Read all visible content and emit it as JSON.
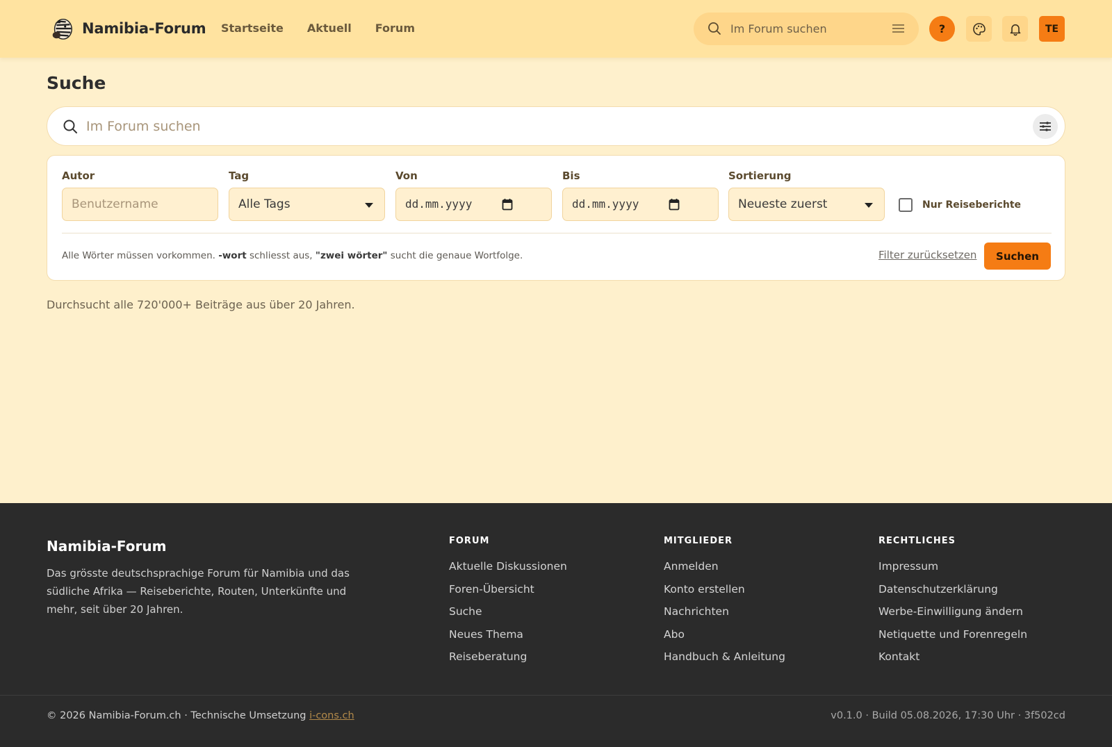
{
  "header": {
    "brand": "Namibia-Forum",
    "nav": [
      "Startseite",
      "Aktuell",
      "Forum"
    ],
    "search_placeholder": "Im Forum suchen",
    "help_label": "?",
    "avatar_initials": "TE"
  },
  "main": {
    "title": "Suche",
    "search_placeholder": "Im Forum suchen",
    "filters": {
      "author_label": "Autor",
      "author_placeholder": "Benutzername",
      "tag_label": "Tag",
      "tag_value": "Alle Tags",
      "from_label": "Von",
      "from_placeholder": "dd.mm.yyyy",
      "to_label": "Bis",
      "to_placeholder": "dd.mm.yyyy",
      "sort_label": "Sortierung",
      "sort_value": "Neueste zuerst",
      "travel_only_label": "Nur Reiseberichte",
      "travel_only_checked": false
    },
    "hint": {
      "part1": "Alle Wörter müssen vorkommen. ",
      "bold1": "-wort",
      "part2": " schliesst aus, ",
      "bold2": "\"zwei wörter\"",
      "part3": " sucht die genaue Wortfolge."
    },
    "reset_label": "Filter zurücksetzen",
    "submit_label": "Suchen",
    "note": "Durchsucht alle 720'000+ Beiträge aus über 20 Jahren."
  },
  "footer": {
    "brand": "Namibia-Forum",
    "description": "Das grösste deutschsprachige Forum für Namibia und das südliche Afrika — Reiseberichte, Routen, Unterkünfte und mehr, seit über 20 Jahren.",
    "columns": [
      {
        "title": "FORUM",
        "links": [
          "Aktuelle Diskussionen",
          "Foren-Übersicht",
          "Suche",
          "Neues Thema",
          "Reiseberatung"
        ]
      },
      {
        "title": "MITGLIEDER",
        "links": [
          "Anmelden",
          "Konto erstellen",
          "Nachrichten",
          "Abo",
          "Handbuch & Anleitung"
        ]
      },
      {
        "title": "RECHTLICHES",
        "links": [
          "Impressum",
          "Datenschutzerklärung",
          "Werbe-Einwilligung ändern",
          "Netiquette und Forenregeln",
          "Kontakt"
        ]
      }
    ],
    "copyright": "© 2026 Namibia-Forum.ch · Technische Umsetzung ",
    "credit_link": "i-cons.ch",
    "build": "v0.1.0 · Build 05.08.2026, 17:30 Uhr · 3f502cd"
  },
  "colors": {
    "accent": "#f57c14",
    "header_bg": "#ffe3a0",
    "page_bg": "#fef0cc",
    "footer_bg": "#2b2b2b"
  },
  "icons": [
    "zebra-logo-icon",
    "search-icon",
    "filter-icon",
    "palette-icon",
    "bell-icon",
    "calendar-icon",
    "chevron-down-icon"
  ]
}
